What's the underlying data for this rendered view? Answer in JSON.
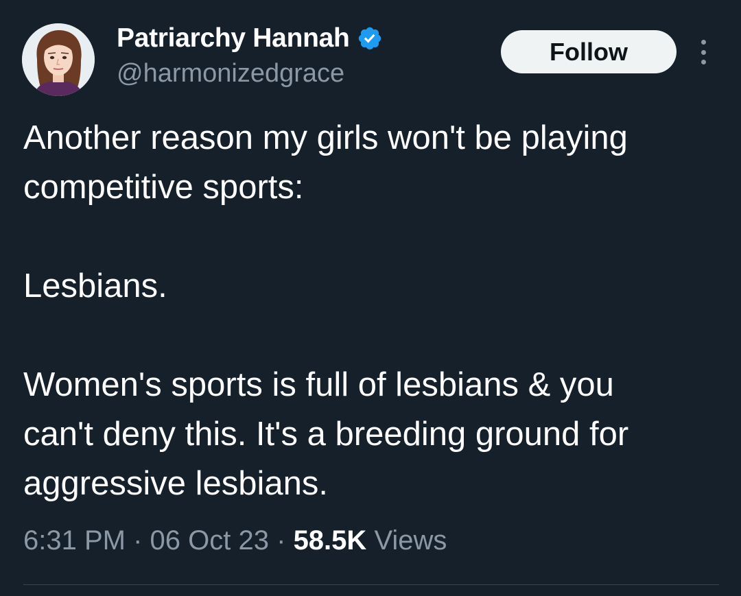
{
  "author": {
    "display_name": "Patriarchy Hannah",
    "handle": "@harmonizedgrace",
    "verified": true,
    "verified_color": "#1d9bf0",
    "avatar_icon": "cartoon-woman-avatar"
  },
  "actions": {
    "follow_label": "Follow",
    "more_icon": "three-dots-vertical-icon"
  },
  "tweet": {
    "paragraphs": [
      "Another reason my girls won't be playing\ncompetitive sports:",
      "Lesbians.",
      "Women's sports is full of lesbians & you\ncan't deny this. It's a breeding ground for\naggressive lesbians."
    ]
  },
  "meta": {
    "time": "6:31 PM",
    "separator": "·",
    "date": "06 Oct 23",
    "views_count": "58.5K",
    "views_label": "Views"
  },
  "colors": {
    "background": "#15202b",
    "text": "#ffffff",
    "secondary_text": "#8b98a5",
    "divider": "#38444d",
    "button_bg": "#eff3f4"
  }
}
